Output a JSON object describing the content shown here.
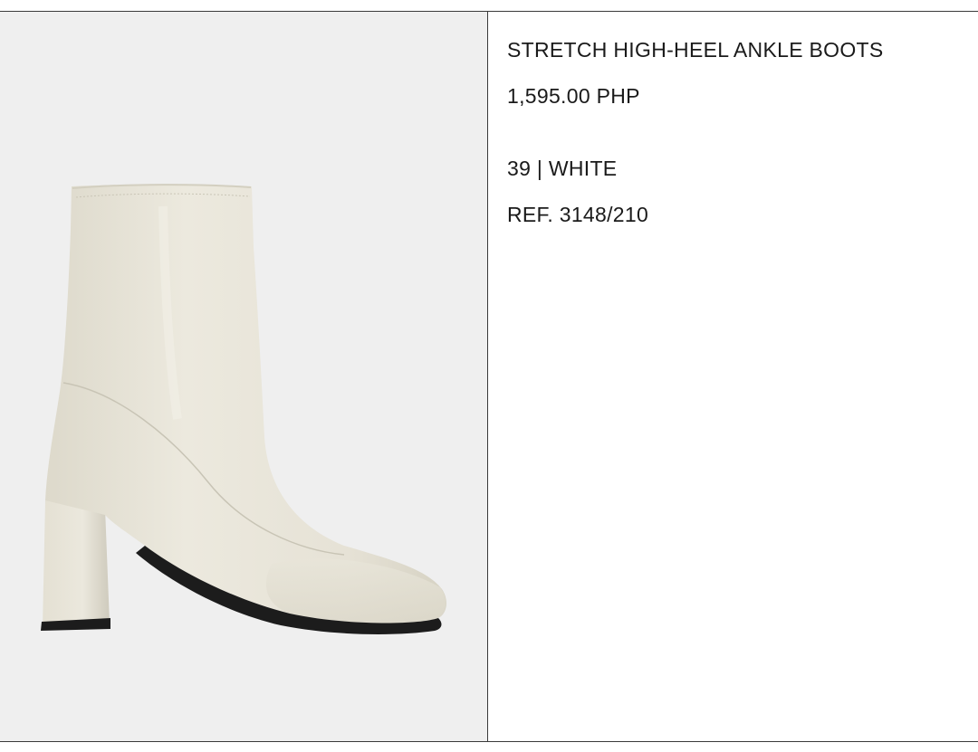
{
  "product": {
    "title": "STRETCH HIGH-HEEL ANKLE BOOTS",
    "price": "1,595.00 PHP",
    "variant": "39 | WHITE",
    "reference": "REF. 3148/210"
  },
  "image": {
    "subject": "boot-icon",
    "background_color": "#efefef",
    "boot_color": "#e9e6da",
    "sole_color": "#1c1c1c"
  }
}
